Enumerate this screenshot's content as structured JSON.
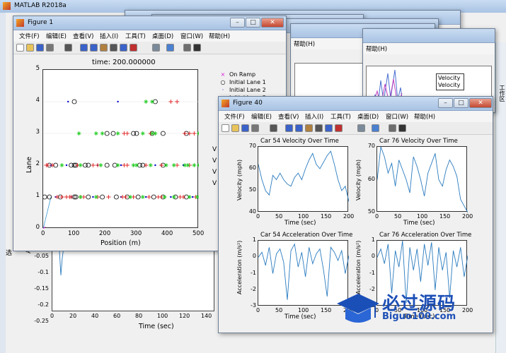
{
  "desktop": {
    "app_title": "MATLAB R2018a"
  },
  "menus": [
    "文件(F)",
    "编辑(E)",
    "查看(V)",
    "插入(I)",
    "工具(T)",
    "桌面(D)",
    "窗口(W)",
    "帮助(H)"
  ],
  "back_windows": {
    "menu_fragment": "帮助(H)",
    "legend_lines": [
      "Velocity",
      "Velocity"
    ]
  },
  "fig1": {
    "title": "Figure 1",
    "plot_title": "time: 200.000000",
    "xlabel": "Position (m)",
    "ylabel": "Lane",
    "xticks": [
      "0",
      "100",
      "200",
      "300",
      "400",
      "500"
    ],
    "yticks": [
      "0",
      "1",
      "2",
      "3",
      "4",
      "5"
    ],
    "legend": [
      "On Ramp",
      "Initial Lane 1",
      "Initial Lane 2",
      "Initial Lane 3"
    ],
    "cut_labels": [
      "V",
      "V",
      "V",
      "V"
    ]
  },
  "fig40": {
    "title": "Figure 40",
    "plots": [
      {
        "title": "Car 54 Velocity Over Time",
        "ylabel": "Velocity (mph)",
        "xlabel": "Time (sec)",
        "yticks": [
          "40",
          "50",
          "60",
          "70"
        ],
        "xticks": [
          "0",
          "50",
          "100",
          "150",
          "200"
        ]
      },
      {
        "title": "Car 76 Velocity Over Time",
        "ylabel": "Velocity (mph)",
        "xlabel": "Time (sec)",
        "yticks": [
          "50",
          "60",
          "70"
        ],
        "xticks": [
          "0",
          "50",
          "100",
          "150",
          "200"
        ]
      },
      {
        "title": "Car 54 Acceleration Over Time",
        "ylabel": "Acceleration (m/s²)",
        "xlabel": "Time (sec)",
        "yticks": [
          "-3",
          "-2",
          "-1",
          "0",
          "1"
        ],
        "xticks": [
          "0",
          "50",
          "100",
          "150",
          "200"
        ]
      },
      {
        "title": "Car 76 Acceleration Over Time",
        "ylabel": "Acceleration (m/s²)",
        "xlabel": "Time (sec)",
        "yticks": [
          "-3",
          "-2",
          "-1",
          "0",
          "1"
        ],
        "xticks": [
          "0",
          "50",
          "100",
          "150",
          "200"
        ]
      }
    ]
  },
  "bottom_plot": {
    "xlabel": "Time (sec)",
    "xticks": [
      "0",
      "20",
      "40",
      "60",
      "80",
      "100",
      "120",
      "140"
    ],
    "yticks": [
      "-0.05",
      "-0.1",
      "-0.15",
      "-0.2",
      "-0.25"
    ],
    "ylabel_fragment": "Ac",
    "left_fragment": "选"
  },
  "watermark": {
    "cn": "必过源码",
    "url": "Biguo100.com"
  },
  "right_edge_text": "工作区",
  "chart_data": {
    "type": "scatter",
    "title": "time: 200.000000",
    "xlabel": "Position (m)",
    "ylabel": "Lane",
    "xlim": [
      0,
      500
    ],
    "ylim": [
      0,
      5
    ],
    "legend_position": "right",
    "series": [
      {
        "name": "On Ramp",
        "marker": "x",
        "color": "#e020e0",
        "points": [
          [
            0,
            0
          ]
        ]
      },
      {
        "name": "Initial Lane 1",
        "marker": "o",
        "color": "#000000",
        "points": [
          [
            5,
            1
          ],
          [
            20,
            1
          ],
          [
            55,
            1
          ],
          [
            100,
            1
          ],
          [
            105,
            1
          ],
          [
            145,
            1
          ],
          [
            190,
            1
          ],
          [
            235,
            1
          ],
          [
            270,
            1
          ],
          [
            305,
            1
          ],
          [
            355,
            1
          ],
          [
            385,
            1
          ],
          [
            425,
            1
          ],
          [
            460,
            1
          ],
          [
            20,
            2
          ],
          [
            40,
            2
          ],
          [
            90,
            2
          ],
          [
            100,
            2
          ],
          [
            105,
            2
          ],
          [
            135,
            2
          ],
          [
            145,
            2
          ],
          [
            205,
            2
          ],
          [
            230,
            2
          ],
          [
            310,
            2
          ],
          [
            320,
            2
          ],
          [
            385,
            2
          ],
          [
            205,
            3
          ],
          [
            225,
            3
          ],
          [
            290,
            3
          ],
          [
            300,
            3
          ],
          [
            350,
            3
          ],
          [
            385,
            3
          ],
          [
            460,
            3
          ],
          [
            100,
            4
          ],
          [
            360,
            4
          ]
        ]
      },
      {
        "name": "Initial Lane 2",
        "marker": ".",
        "color": "#0000cc",
        "points": [
          [
            40,
            1
          ],
          [
            90,
            1
          ],
          [
            160,
            1
          ],
          [
            250,
            1
          ],
          [
            330,
            1
          ],
          [
            410,
            1
          ],
          [
            480,
            1
          ],
          [
            25,
            2
          ],
          [
            75,
            2
          ],
          [
            175,
            2
          ],
          [
            250,
            2
          ],
          [
            360,
            2
          ],
          [
            450,
            2
          ],
          [
            80,
            4
          ],
          [
            240,
            4
          ]
        ]
      },
      {
        "name": "Initial Lane 3",
        "marker": "+",
        "color": "#e02020",
        "points": [
          [
            45,
            1
          ],
          [
            60,
            1
          ],
          [
            75,
            1
          ],
          [
            85,
            1
          ],
          [
            90,
            1
          ],
          [
            120,
            1
          ],
          [
            130,
            1
          ],
          [
            175,
            1
          ],
          [
            210,
            1
          ],
          [
            255,
            1
          ],
          [
            265,
            1
          ],
          [
            290,
            1
          ],
          [
            340,
            1
          ],
          [
            370,
            1
          ],
          [
            380,
            1
          ],
          [
            440,
            1
          ],
          [
            450,
            1
          ],
          [
            490,
            1
          ],
          [
            10,
            2
          ],
          [
            15,
            2
          ],
          [
            30,
            2
          ],
          [
            110,
            2
          ],
          [
            160,
            2
          ],
          [
            175,
            2
          ],
          [
            260,
            2
          ],
          [
            270,
            2
          ],
          [
            330,
            2
          ],
          [
            380,
            2
          ],
          [
            430,
            2
          ],
          [
            470,
            2
          ],
          [
            260,
            3
          ],
          [
            270,
            3
          ],
          [
            345,
            3
          ],
          [
            455,
            3
          ],
          [
            470,
            3
          ],
          [
            485,
            3
          ],
          [
            410,
            4
          ],
          [
            430,
            4
          ]
        ]
      },
      {
        "name": "",
        "marker": "*",
        "color": "#22cc22",
        "points": [
          [
            120,
            1
          ],
          [
            170,
            1
          ],
          [
            280,
            1
          ],
          [
            320,
            1
          ],
          [
            390,
            1
          ],
          [
            420,
            1
          ],
          [
            470,
            1
          ],
          [
            495,
            1
          ],
          [
            60,
            2
          ],
          [
            120,
            2
          ],
          [
            185,
            2
          ],
          [
            240,
            2
          ],
          [
            290,
            2
          ],
          [
            300,
            2
          ],
          [
            345,
            2
          ],
          [
            395,
            2
          ],
          [
            420,
            2
          ],
          [
            455,
            2
          ],
          [
            465,
            2
          ],
          [
            485,
            2
          ],
          [
            500,
            2
          ],
          [
            115,
            3
          ],
          [
            170,
            3
          ],
          [
            190,
            3
          ],
          [
            240,
            3
          ],
          [
            320,
            3
          ],
          [
            350,
            3
          ],
          [
            360,
            3
          ],
          [
            500,
            3
          ],
          [
            330,
            4
          ],
          [
            350,
            4
          ]
        ]
      }
    ]
  }
}
